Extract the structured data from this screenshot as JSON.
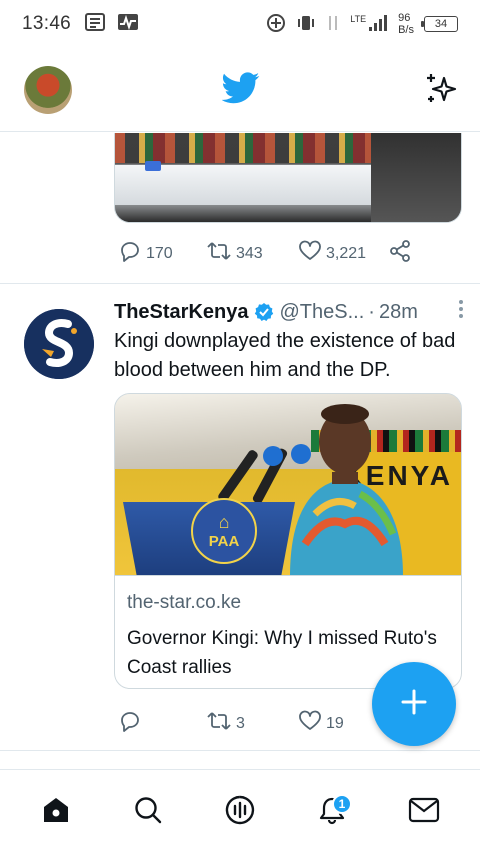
{
  "status_bar": {
    "time": "13:46",
    "network": "LTE",
    "speed_value": "96",
    "speed_unit": "B/s",
    "battery": "34"
  },
  "top_bar": {
    "logo_icon": "twitter-bird-icon",
    "sparkle_icon": "sparkle-icon"
  },
  "prev_tweet": {
    "replies": "170",
    "retweets": "343",
    "likes": "3,221"
  },
  "tweet": {
    "display_name": "TheStarKenya",
    "handle": "@TheS...",
    "separator": "·",
    "age": "28m",
    "text": "Kingi downplayed the existence of bad blood between him and the DP.",
    "card": {
      "domain": "the-star.co.ke",
      "title": "Governor Kingi: Why I missed Ruto's Coast rallies",
      "image_text": "KENYA",
      "podium_text": "PAA"
    },
    "replies": "",
    "retweets": "3",
    "likes": "19"
  },
  "bottom_nav": {
    "items": [
      "home-icon",
      "search-icon",
      "spaces-icon",
      "notifications-icon",
      "messages-icon"
    ],
    "notifications_badge": "1"
  },
  "colors": {
    "accent": "#1da1f2",
    "text": "#0f1419",
    "muted": "#536471",
    "border": "#e1e8ed"
  }
}
